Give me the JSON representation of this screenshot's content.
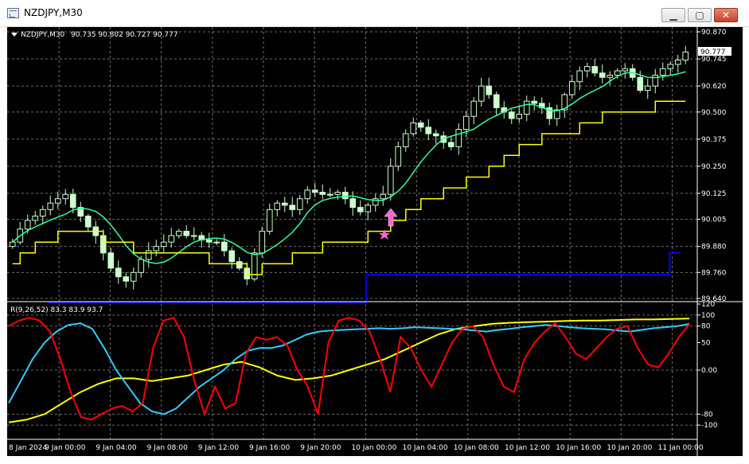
{
  "window": {
    "title": "NZDJPY,M30",
    "minimize_label": "▁",
    "maximize_label": "▢",
    "close_label": "✕"
  },
  "colors": {
    "background": "#000000",
    "grid": "#6e6e6e",
    "text": "#ffffff",
    "bull_candle": "#ccffcc",
    "bear_candle": "#ccffcc",
    "wick": "#ccffcc",
    "ma_green": "#33ff99",
    "ma_yellow": "#ffff00",
    "ma_blue": "#0000ff",
    "rsi_red": "#ff0000",
    "rsi_cyan": "#33ccff",
    "rsi_yellow": "#ffff00",
    "arrow": "#ff66cc",
    "star": "#ff66cc"
  },
  "price_panel": {
    "header_symbol": "NZDJPY,M30",
    "header_ohlc": "90.735 90.802 90.727 90.777",
    "current_price_label": "90.777",
    "price_levels": [
      "90.870",
      "90.745",
      "90.620",
      "90.500",
      "90.375",
      "90.250",
      "90.125",
      "90.005",
      "89.880",
      "89.760",
      "89.640"
    ],
    "y_min": 89.64,
    "y_max": 90.87,
    "signal_arrow": "up-arrow",
    "signal_star": "star"
  },
  "indicator_panel": {
    "header": "R(9,26,52) 83.3 83.9 93.7",
    "levels": [
      "120",
      "100",
      "80",
      "0.00",
      "-80",
      "-100",
      "50"
    ],
    "y_min": -120,
    "y_max": 120
  },
  "time_labels": [
    "8 Jan 2024",
    "9 Jan 00:00",
    "9 Jan 04:00",
    "9 Jan 08:00",
    "9 Jan 12:00",
    "9 Jan 16:00",
    "9 Jan 20:00",
    "10 Jan 00:00",
    "10 Jan 04:00",
    "10 Jan 08:00",
    "10 Jan 12:00",
    "10 Jan 16:00",
    "10 Jan 20:00",
    "11 Jan 00:00"
  ],
  "chart_data": {
    "type": "candlestick",
    "symbol": "NZDJPY",
    "timeframe": "M30",
    "ohlc_current": {
      "open": 90.735,
      "high": 90.802,
      "low": 90.727,
      "close": 90.777
    },
    "ylim": [
      89.64,
      90.87
    ],
    "close_path": [
      89.9,
      89.96,
      90.0,
      90.02,
      90.05,
      90.08,
      90.1,
      90.12,
      90.06,
      90.02,
      89.97,
      89.93,
      89.85,
      89.78,
      89.74,
      89.72,
      89.76,
      89.82,
      89.86,
      89.88,
      89.9,
      89.93,
      89.95,
      89.93,
      89.93,
      89.91,
      89.9,
      89.9,
      89.86,
      89.81,
      89.78,
      89.73,
      89.85,
      89.95,
      90.05,
      90.08,
      90.07,
      90.05,
      90.1,
      90.14,
      90.13,
      90.12,
      90.12,
      90.13,
      90.1,
      90.06,
      90.04,
      90.07,
      90.1,
      90.12,
      90.25,
      90.34,
      90.4,
      90.45,
      90.43,
      90.4,
      90.39,
      90.36,
      90.34,
      90.42,
      90.48,
      90.55,
      90.62,
      90.58,
      90.52,
      90.5,
      90.47,
      90.49,
      90.55,
      90.54,
      90.52,
      90.47,
      90.51,
      90.58,
      90.64,
      90.69,
      90.71,
      90.68,
      90.66,
      90.67,
      90.69,
      90.7,
      90.66,
      90.6,
      90.62,
      90.67,
      90.7,
      90.72,
      90.74,
      90.777
    ],
    "indicator": {
      "name": "R(9,26,52)",
      "values": [
        83.3,
        83.9,
        93.7
      ],
      "ylim": [
        -120,
        120
      ],
      "red_path": [
        80,
        90,
        95,
        90,
        70,
        20,
        -40,
        -85,
        -90,
        -80,
        -70,
        -65,
        -75,
        -60,
        40,
        90,
        95,
        60,
        -20,
        -80,
        -30,
        -70,
        -60,
        30,
        60,
        55,
        60,
        45,
        0,
        -30,
        -80,
        50,
        90,
        95,
        90,
        70,
        20,
        -40,
        60,
        40,
        0,
        -30,
        10,
        50,
        75,
        80,
        60,
        10,
        -30,
        -40,
        20,
        50,
        70,
        85,
        60,
        30,
        20,
        40,
        60,
        75,
        80,
        40,
        10,
        5,
        30,
        60,
        83.3
      ],
      "cyan_path": [
        -60,
        -20,
        20,
        50,
        70,
        82,
        85,
        75,
        40,
        0,
        -30,
        -60,
        -75,
        -80,
        -70,
        -50,
        -30,
        -15,
        0,
        20,
        35,
        40,
        40,
        45,
        55,
        65,
        70,
        72,
        73,
        74,
        75,
        76,
        75,
        76,
        78,
        77,
        76,
        75,
        74,
        72,
        70,
        73,
        75,
        78,
        80,
        82,
        80,
        78,
        76,
        75,
        74,
        72,
        70,
        73,
        76,
        78,
        80,
        83.9
      ],
      "yellow_path": [
        -95,
        -90,
        -80,
        -60,
        -40,
        -25,
        -15,
        -15,
        -20,
        -15,
        -10,
        0,
        10,
        15,
        5,
        -10,
        -18,
        -15,
        -10,
        0,
        10,
        20,
        35,
        50,
        65,
        75,
        80,
        84,
        86,
        87,
        88,
        89,
        90,
        90,
        91,
        92,
        92,
        93,
        93.7
      ]
    }
  }
}
